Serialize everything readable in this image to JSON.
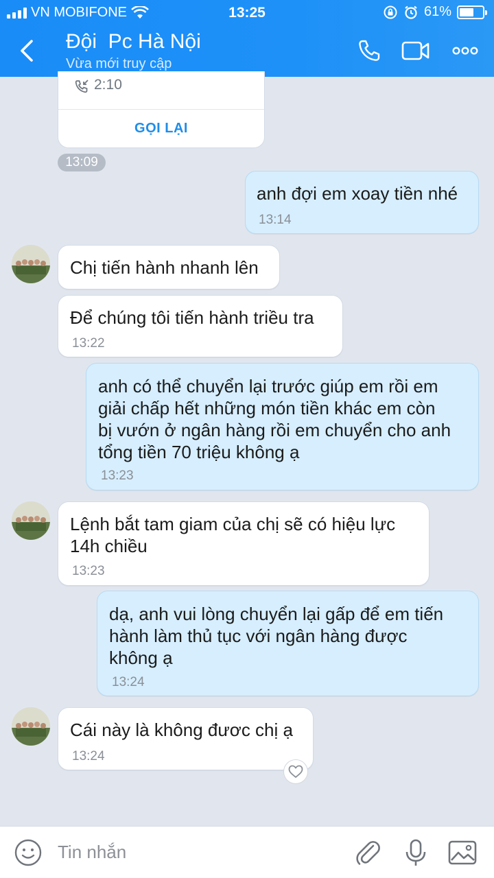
{
  "status_bar": {
    "carrier": "VN MOBIFONE",
    "time": "13:25",
    "battery": "61%",
    "battery_level": 0.61
  },
  "header": {
    "title": "Đội  Pc Hà Nội",
    "subtitle": "Vừa mới truy cập",
    "icons": [
      "back-icon",
      "phone-icon",
      "video-call-icon",
      "more-icon"
    ]
  },
  "call_card": {
    "duration": "2:10",
    "action_label": "GỌI LẠI",
    "timestamp": "13:09"
  },
  "messages": [
    {
      "side": "me",
      "text": "anh đợi em xoay tiền nhé",
      "time": "13:14"
    },
    {
      "side": "them",
      "text": "Chị tiến hành nhanh lên",
      "time": ""
    },
    {
      "side": "them",
      "text": "Để chúng tôi tiến hành triều tra",
      "time": "13:22"
    },
    {
      "side": "me",
      "lines": [
        "anh có thể chuyển lại trước giúp em rồi em",
        "giải chấp hết những món tiền khác em còn",
        "bị vướn ở ngân hàng rồi em chuyển cho anh",
        "tổng tiền 70 triệu không ạ"
      ],
      "time": "13:23"
    },
    {
      "side": "them",
      "lines": [
        "Lệnh bắt tam giam của chị sẽ có hiệu lực",
        "14h chiều"
      ],
      "time": "13:23"
    },
    {
      "side": "me",
      "lines": [
        "dạ, anh vui lòng chuyển lại gấp để em tiến",
        "hành làm thủ tục với ngân hàng được",
        "không ạ"
      ],
      "time": "13:24"
    },
    {
      "side": "them",
      "text": "Cái này là không đươc chị ạ",
      "time": "13:24"
    }
  ],
  "composer": {
    "placeholder": "Tin nhắn"
  },
  "colors": {
    "header": "#1e91f8",
    "chat_bg": "#e1e6ee",
    "my_bubble": "#d6eefe",
    "their_bubble": "#ffffff",
    "accent": "#1f8de7"
  }
}
